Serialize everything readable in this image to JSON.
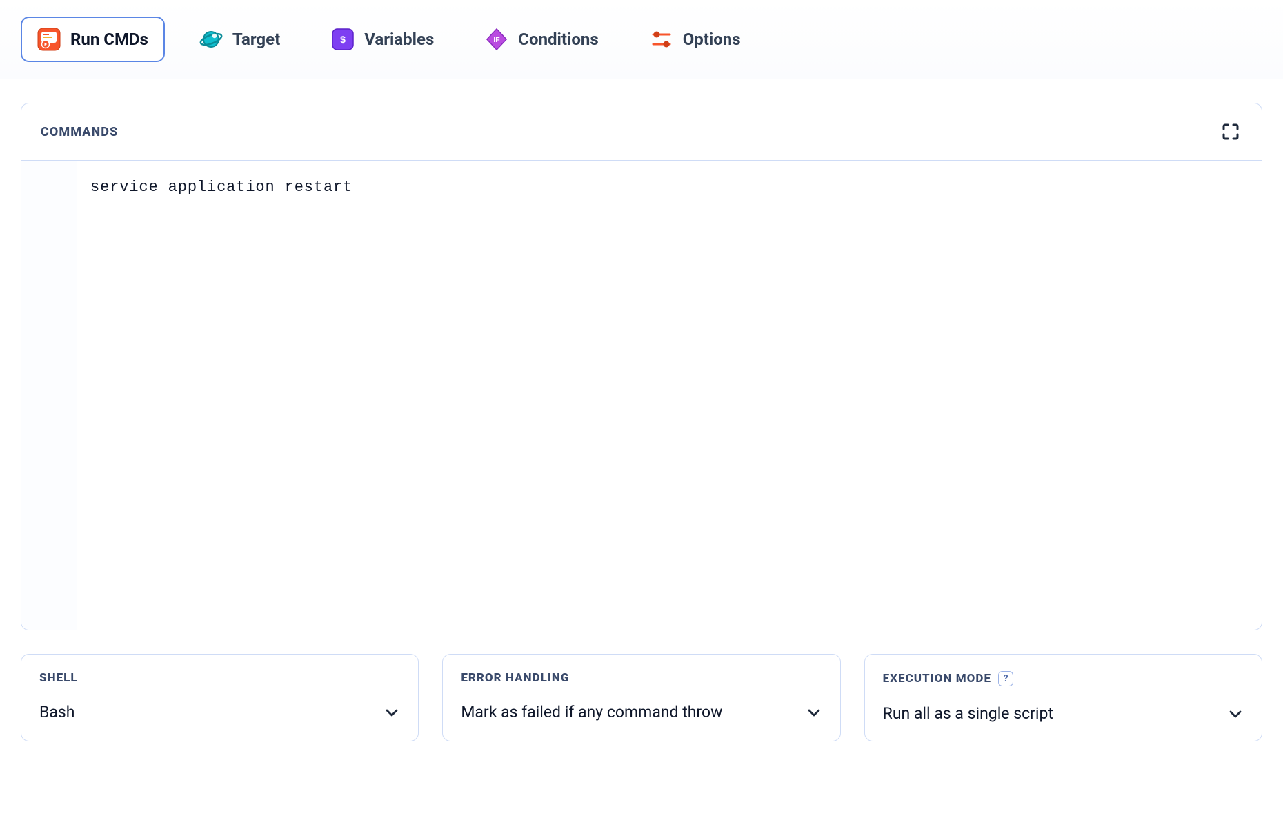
{
  "tabs": {
    "run_cmds": "Run CMDs",
    "target": "Target",
    "variables": "Variables",
    "conditions": "Conditions",
    "options": "Options"
  },
  "commands_panel": {
    "title": "COMMANDS",
    "code": "service application restart"
  },
  "selects": {
    "shell": {
      "label": "SHELL",
      "value": "Bash"
    },
    "error_handling": {
      "label": "ERROR HANDLING",
      "value": "Mark as failed if any command throw"
    },
    "execution_mode": {
      "label": "EXECUTION MODE",
      "value": "Run all as a single script",
      "help": "?"
    }
  }
}
